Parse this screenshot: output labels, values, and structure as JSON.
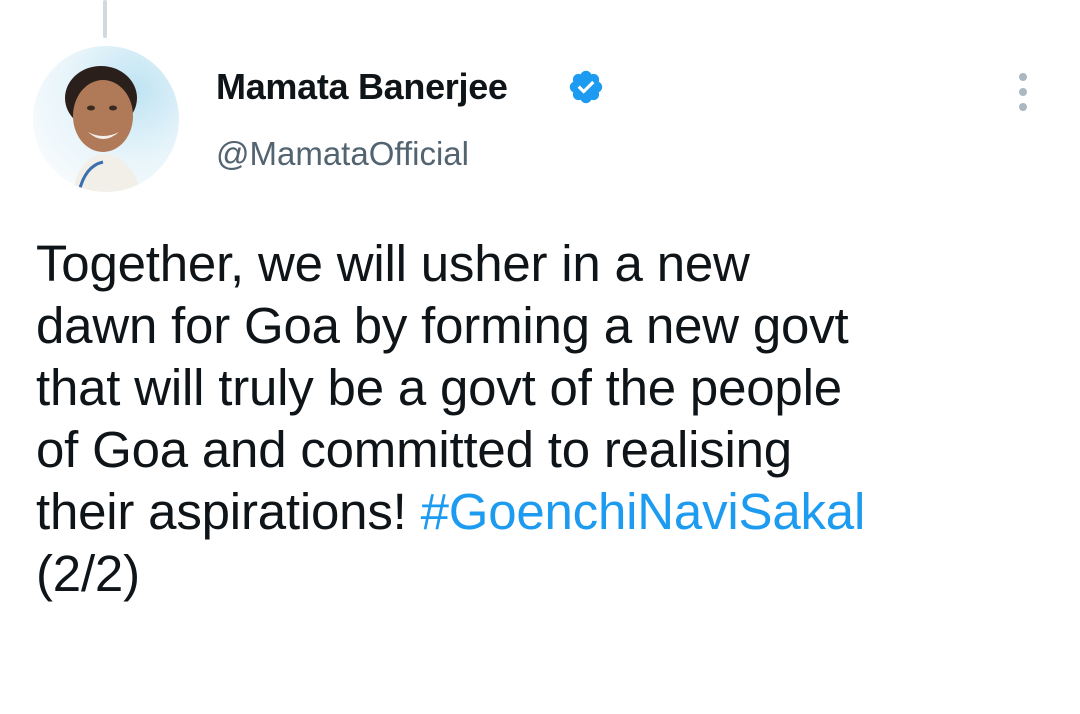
{
  "tweet": {
    "author": {
      "display_name": "Mamata Banerjee",
      "handle": "@MamataOfficial",
      "verified": true,
      "avatar_icon": "profile-photo"
    },
    "text_lines": [
      "Together, we will usher in a new",
      "dawn for Goa by forming a new govt",
      "that will truly be a govt of the people",
      "of Goa and committed to realising"
    ],
    "last_line_text": "their aspirations! ",
    "hashtag": "#GoenchiNaviSakal",
    "thread_marker": "(2/2)",
    "more_icon": "more-options-icon"
  },
  "colors": {
    "text": "#0f1419",
    "handle": "#536471",
    "hashtag": "#1d9bf0",
    "verified_badge": "#1d9bf0"
  }
}
